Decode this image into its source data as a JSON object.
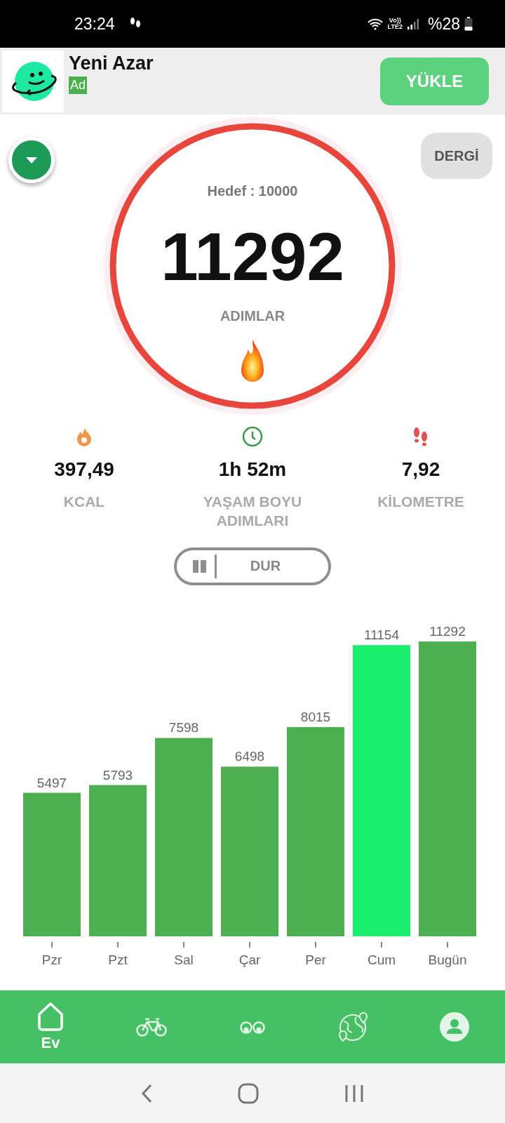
{
  "status_bar": {
    "time": "23:24",
    "network": "Vo))\nLTE2",
    "battery_text": "%28"
  },
  "ad": {
    "title": "Yeni Azar",
    "badge": "Ad",
    "button": "YÜKLE"
  },
  "journal_button": "DERGİ",
  "goal": {
    "label": "Hedef : 10000",
    "steps": "11292",
    "unit": "ADIMLAR"
  },
  "stats": [
    {
      "kind": "calories",
      "value": "397,49",
      "label": "KCAL"
    },
    {
      "kind": "time",
      "value": "1h 52m",
      "label": "YAŞAM BOYU ADIMLARI"
    },
    {
      "kind": "distance",
      "value": "7,92",
      "label": "KİLOMETRE"
    }
  ],
  "pause_button": {
    "label": "DUR"
  },
  "chart_data": {
    "type": "bar",
    "categories": [
      "Pzr",
      "Pzt",
      "Sal",
      "Çar",
      "Per",
      "Cum",
      "Bugün"
    ],
    "values": [
      5497,
      5793,
      7598,
      6498,
      8015,
      11154,
      11292
    ],
    "data_labels": true
  },
  "chart_bars": [
    {
      "highlighted": false
    },
    {
      "highlighted": false
    },
    {
      "highlighted": false
    },
    {
      "highlighted": false
    },
    {
      "highlighted": false
    },
    {
      "highlighted": true
    },
    {
      "highlighted": false
    }
  ],
  "bottom_nav": [
    {
      "kind": "home",
      "label": "Ev",
      "selected": true
    },
    {
      "kind": "bike",
      "selected": false
    },
    {
      "kind": "binoculars",
      "selected": false
    },
    {
      "kind": "globe",
      "selected": false
    },
    {
      "kind": "profile",
      "selected": false
    }
  ]
}
